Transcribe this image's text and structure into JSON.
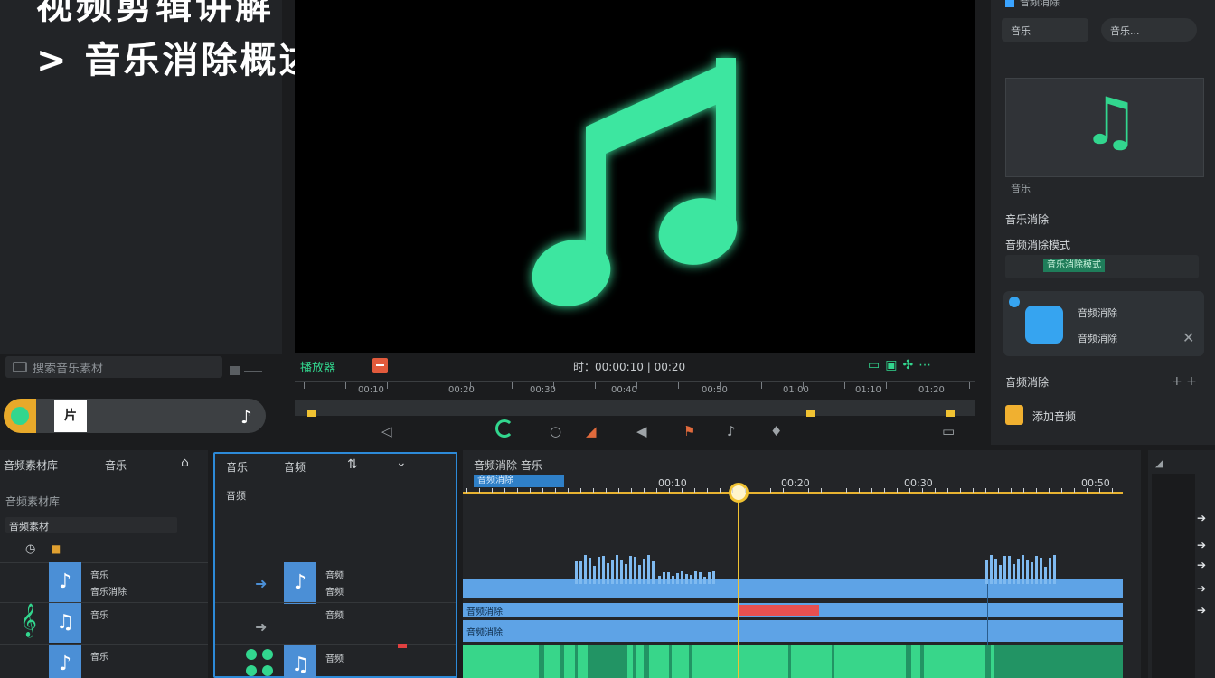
{
  "overlay": {
    "title_line1": "视频剪辑讲解",
    "title_line2": "> 音乐消除概述"
  },
  "left_panel": {
    "search_placeholder": "搜索音乐素材",
    "player_thumb": "片"
  },
  "preview": {
    "toolbar_left": "播放器",
    "timecode": "时：00:00:10 | 00:20",
    "ruler_labels": [
      "00:10",
      "00:20",
      "00:30",
      "00:40",
      "00:50",
      "01:00",
      "01:10",
      "01:20"
    ]
  },
  "right_panel": {
    "tab_label": "音频消除",
    "button_a": "音乐",
    "button_b": "音乐...",
    "preview_caption_left": "音乐",
    "preview_caption_right": "",
    "section_1": "音乐消除",
    "section_2": "音频消除模式",
    "dropdown_value": "音乐消除模式",
    "card_line1": "音频消除",
    "card_line2": "音频消除",
    "section_3": "音频消除",
    "add_item_label": "添加音频"
  },
  "bottom_left": {
    "tab_1": "音频素材库",
    "tab_2": "音乐",
    "filter_text": "音频素材库",
    "field_text": "音频素材",
    "rows": [
      {
        "label1": "音乐",
        "label2": "音乐消除"
      },
      {
        "label1": "音乐"
      },
      {
        "label1": "音乐"
      }
    ]
  },
  "bottom_mid": {
    "tab_1": "音乐",
    "tab_2": "音频",
    "sub_label": "音频",
    "rows": [
      {
        "label1": "音频",
        "label2": "音频"
      },
      {
        "label1": "音频"
      },
      {
        "label1": "音频"
      }
    ]
  },
  "timeline": {
    "header": "音频消除  音乐",
    "highlight": "音频消除",
    "ruler_labels": [
      "00:10",
      "00:20",
      "00:30",
      "00:50"
    ],
    "track_labels": [
      "音频消除",
      "音频消除"
    ]
  },
  "colors": {
    "accent_green": "#32d68e",
    "accent_blue": "#4b8fd6",
    "playhead_yellow": "#f0c232",
    "alert_red": "#e85050"
  }
}
